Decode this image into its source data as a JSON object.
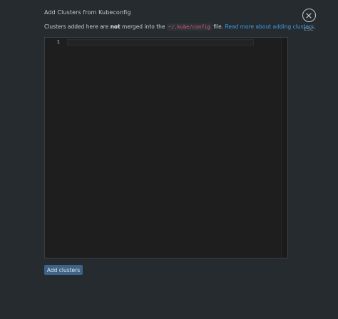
{
  "dialog": {
    "title": "Add Clusters from Kubeconfig",
    "description": {
      "prefix": "Clusters added here are ",
      "emphasis": "not",
      "middle": " merged into the ",
      "path": "~/.kube/config",
      "suffix": " file. ",
      "link": "Read more about adding clusters",
      "end": "."
    },
    "close": {
      "icon": "close-icon",
      "hint": "ESC"
    }
  },
  "editor": {
    "lines": [
      {
        "number": "1",
        "text": ""
      }
    ]
  },
  "actions": {
    "add_clusters_label": "Add clusters"
  },
  "colors": {
    "background": "#262b30",
    "editor_background": "#1e1e1e",
    "link": "#3d9de3",
    "code_path": "#e0566b",
    "primary_button": "#3d6387"
  }
}
